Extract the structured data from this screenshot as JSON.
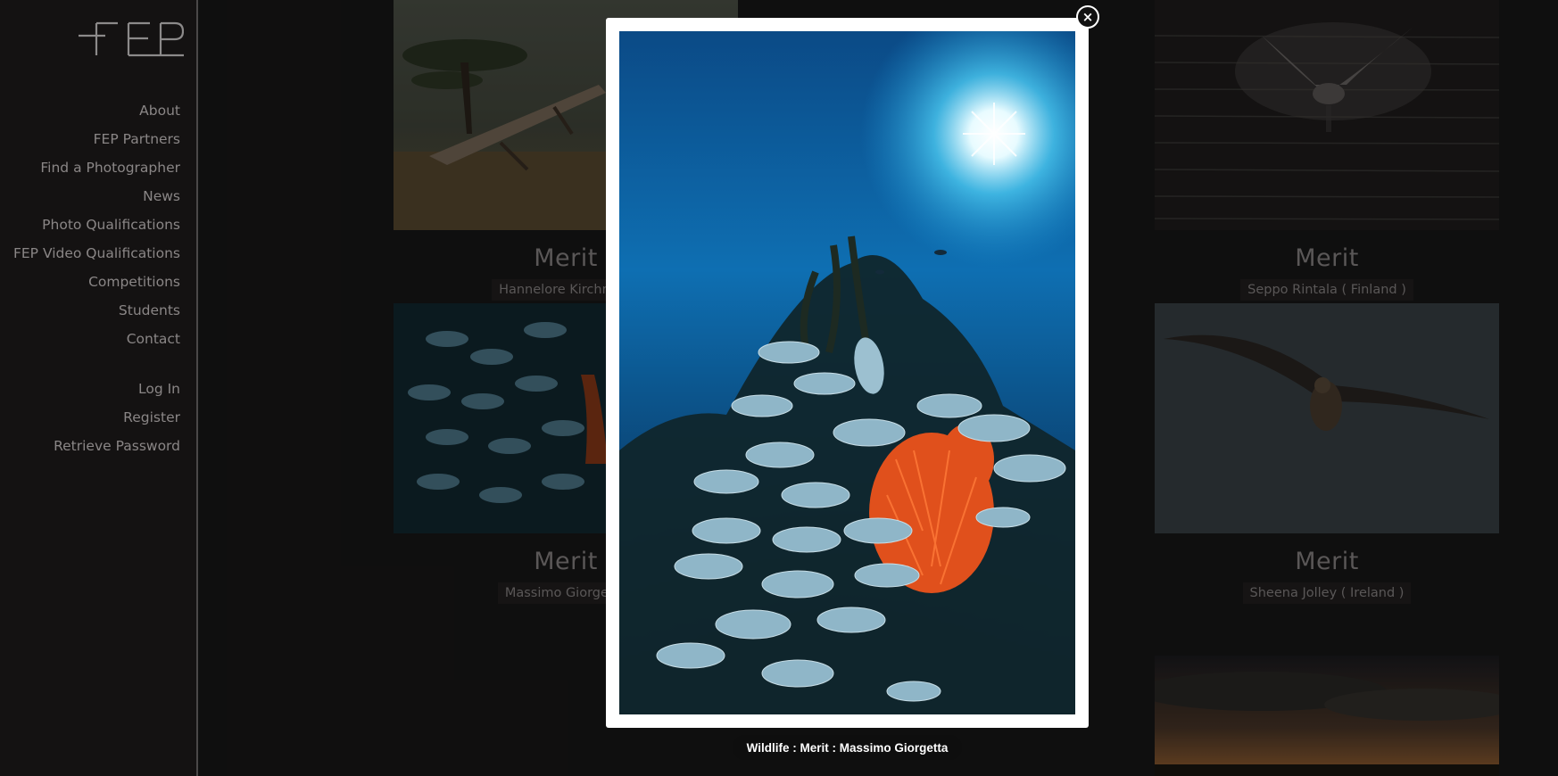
{
  "logo": {
    "text": "FEP"
  },
  "nav": {
    "main": [
      "About",
      "FEP Partners",
      "Find a Photographer",
      "News",
      "Photo Qualifications",
      "FEP Video Qualifications",
      "Competitions",
      "Students",
      "Contact"
    ],
    "account": [
      "Log In",
      "Register",
      "Retrieve Password"
    ]
  },
  "gallery": [
    {
      "award": "Merit",
      "name": "Hannelore Kirchner (",
      "image": "savanna-tree-photo"
    },
    {
      "award": "Merit",
      "name": "Seppo Rintala ( Finland )",
      "image": "swan-photo"
    },
    {
      "award": "Merit",
      "name": "Massimo Giorgetta",
      "image": "fish-school-photo"
    },
    {
      "award": "Merit",
      "name": "Sheena Jolley ( Ireland )",
      "image": "pelican-photo"
    },
    {
      "image": "sunset-landscape-photo"
    }
  ],
  "lightbox": {
    "image": "underwater-fish-school-coral-photo",
    "caption": "Wildlife : Merit : Massimo Giorgetta",
    "close_icon": "close-icon",
    "close_glyph": "×"
  },
  "colors": {
    "background": "#181717",
    "sidebar": "#141212",
    "nav_text": "#8a8686",
    "lightbox_frame": "#ffffff",
    "coral": "#e0501c",
    "fish": "#8fb6c8"
  }
}
